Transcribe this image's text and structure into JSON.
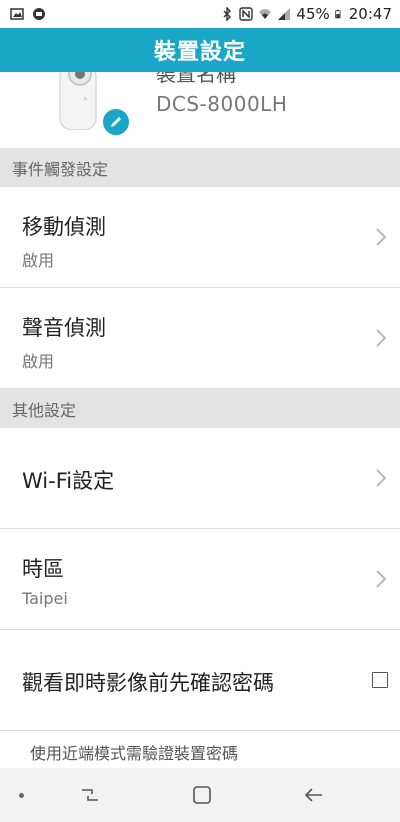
{
  "status_bar": {
    "battery": "45%",
    "time": "20:47",
    "icons": [
      "image-icon",
      "chat-icon",
      "bluetooth-icon",
      "nfc-icon",
      "wifi-icon",
      "signal-icon",
      "battery-icon"
    ]
  },
  "app_bar": {
    "title": "裝置設定"
  },
  "device": {
    "name_partial": "裝置名稱",
    "model": "DCS-8000LH"
  },
  "sections": {
    "events": "事件觸發設定",
    "other": "其他設定"
  },
  "rows": {
    "motion": {
      "title": "移動偵測",
      "status": "啟用"
    },
    "sound": {
      "title": "聲音偵測",
      "status": "啟用"
    },
    "wifi": {
      "title": "Wi-Fi設定"
    },
    "timezone": {
      "title": "時區",
      "value": "Taipei"
    },
    "password_confirm": {
      "title": "觀看即時影像前先確認密碼",
      "checked": false
    }
  },
  "footer_note": "使用近端模式需驗證裝置密碼",
  "colors": {
    "accent": "#1aa6c7",
    "section_bg": "#e3e3e3",
    "nav_bg": "#f2f2f2"
  }
}
